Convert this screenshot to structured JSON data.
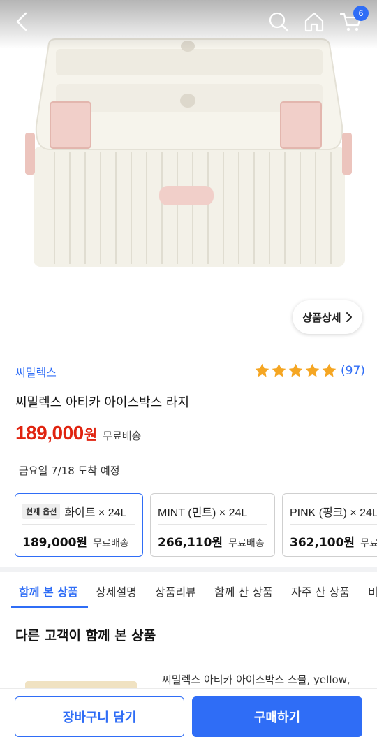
{
  "header": {
    "cart_count": "6"
  },
  "hero": {
    "detail_button_label": "상품상세"
  },
  "product": {
    "brand": "씨밀렉스",
    "rating_count": "(97)",
    "rating_stars": 5,
    "title": "씨밀렉스 아티카 아이스박스 라지",
    "price": "189,000",
    "price_unit": "원",
    "shipping": "무료배송",
    "arrival": "금요일 7/18 도착 예정"
  },
  "options": [
    {
      "badge": "현재 옵션",
      "name": "화이트 × 24L",
      "price": "189,000원",
      "shipping": "무료배송"
    },
    {
      "name": "MINT (민트) × 24L",
      "price": "266,110원",
      "shipping": "무료배송"
    },
    {
      "name": "PINK (핑크) × 24L",
      "price": "362,100원",
      "shipping": "무료배송"
    }
  ],
  "tabs": [
    {
      "label": "함께 본 상품"
    },
    {
      "label": "상세설명"
    },
    {
      "label": "상품리뷰"
    },
    {
      "label": "함께 산 상품"
    },
    {
      "label": "자주 산 상품"
    },
    {
      "label": "비"
    }
  ],
  "recommendations": {
    "title": "다른 고객이 함께 본 상품",
    "first_item_name": "씨밀렉스 아티카 아이스박스 스몰, yellow,"
  },
  "bottom_bar": {
    "cart_button": "장바구니 담기",
    "buy_button": "구매하기"
  },
  "colors": {
    "accent": "#2f6df6",
    "price_red": "#e0230f",
    "star": "#f5a623"
  }
}
